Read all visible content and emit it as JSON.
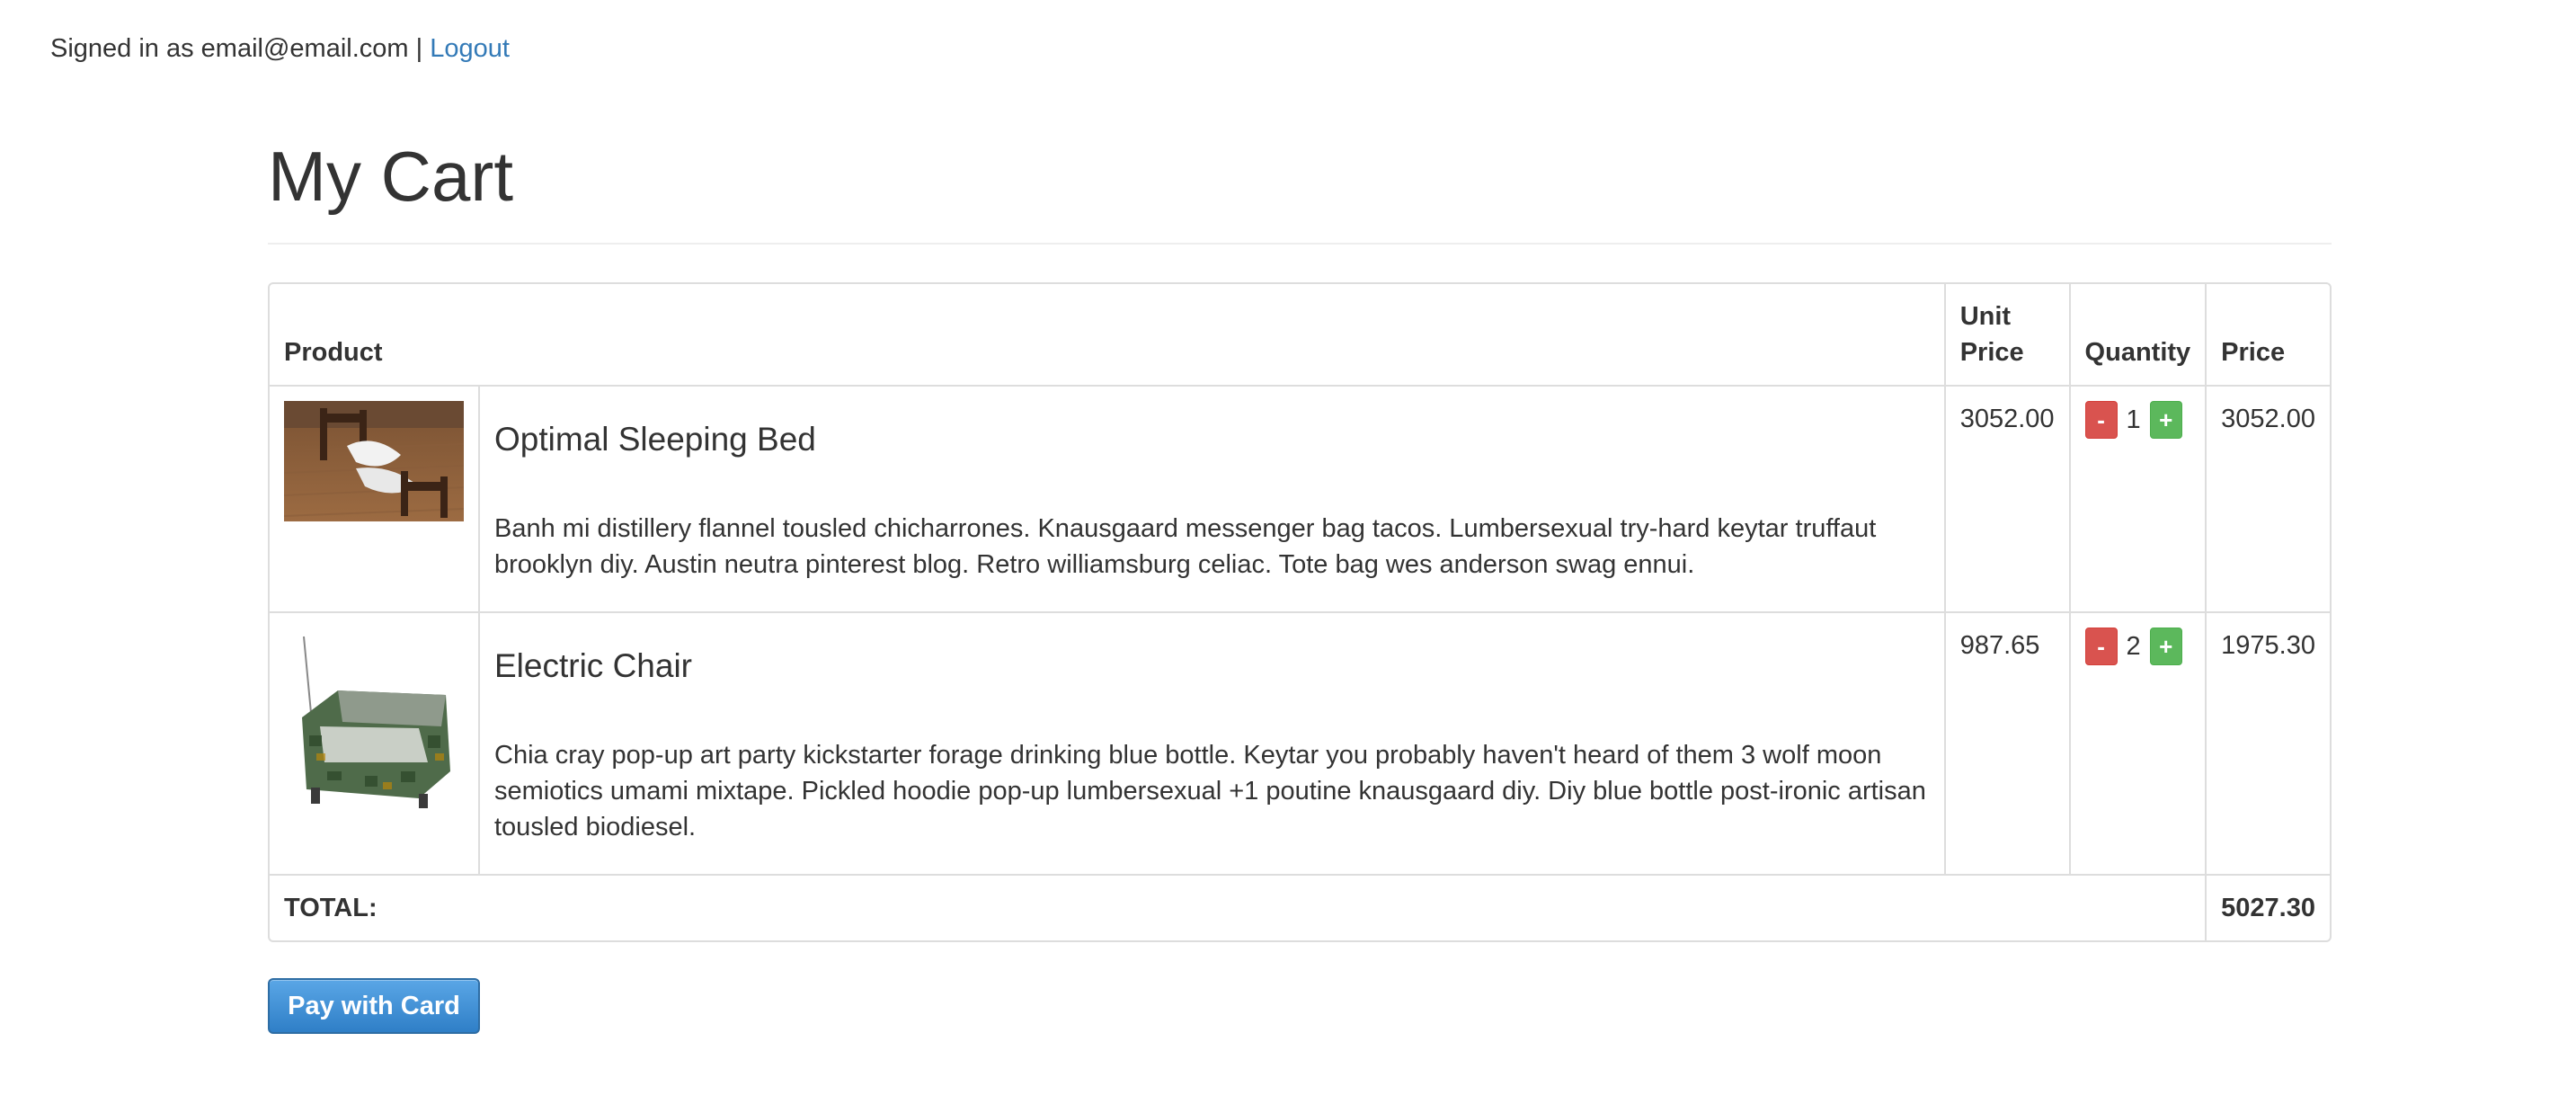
{
  "header": {
    "signed_in_text": "Signed in as email@email.com |",
    "logout_label": "Logout"
  },
  "page": {
    "title": "My Cart"
  },
  "table": {
    "columns": {
      "product": "Product",
      "unit_price_line1": "Unit",
      "unit_price_line2": "Price",
      "quantity": "Quantity",
      "price": "Price"
    },
    "rows": [
      {
        "name": "Optimal Sleeping Bed",
        "description": "Banh mi distillery flannel tousled chicharrones. Knausgaard messenger bag tacos. Lumbersexual try-hard keytar truffaut brooklyn diy. Austin neutra pinterest blog. Retro williamsburg celiac. Tote bag wes anderson swag ennui.",
        "unit_price": "3052.00",
        "quantity": "1",
        "price": "3052.00",
        "minus_label": "-",
        "plus_label": "+"
      },
      {
        "name": "Electric Chair",
        "description": "Chia cray pop-up art party kickstarter forage drinking blue bottle. Keytar you probably haven't heard of them 3 wolf moon semiotics umami mixtape. Pickled hoodie pop-up lumbersexual +1 poutine knausgaard diy. Diy blue bottle post-ironic artisan tousled biodiesel.",
        "unit_price": "987.65",
        "quantity": "2",
        "price": "1975.30",
        "minus_label": "-",
        "plus_label": "+"
      }
    ],
    "total_label": "TOTAL:",
    "total_value": "5027.30"
  },
  "actions": {
    "pay_label": "Pay with Card"
  },
  "colors": {
    "link": "#337ab7",
    "minus_button": "#d9534f",
    "plus_button": "#5cb85c",
    "pay_button": "#3a8fd6"
  }
}
